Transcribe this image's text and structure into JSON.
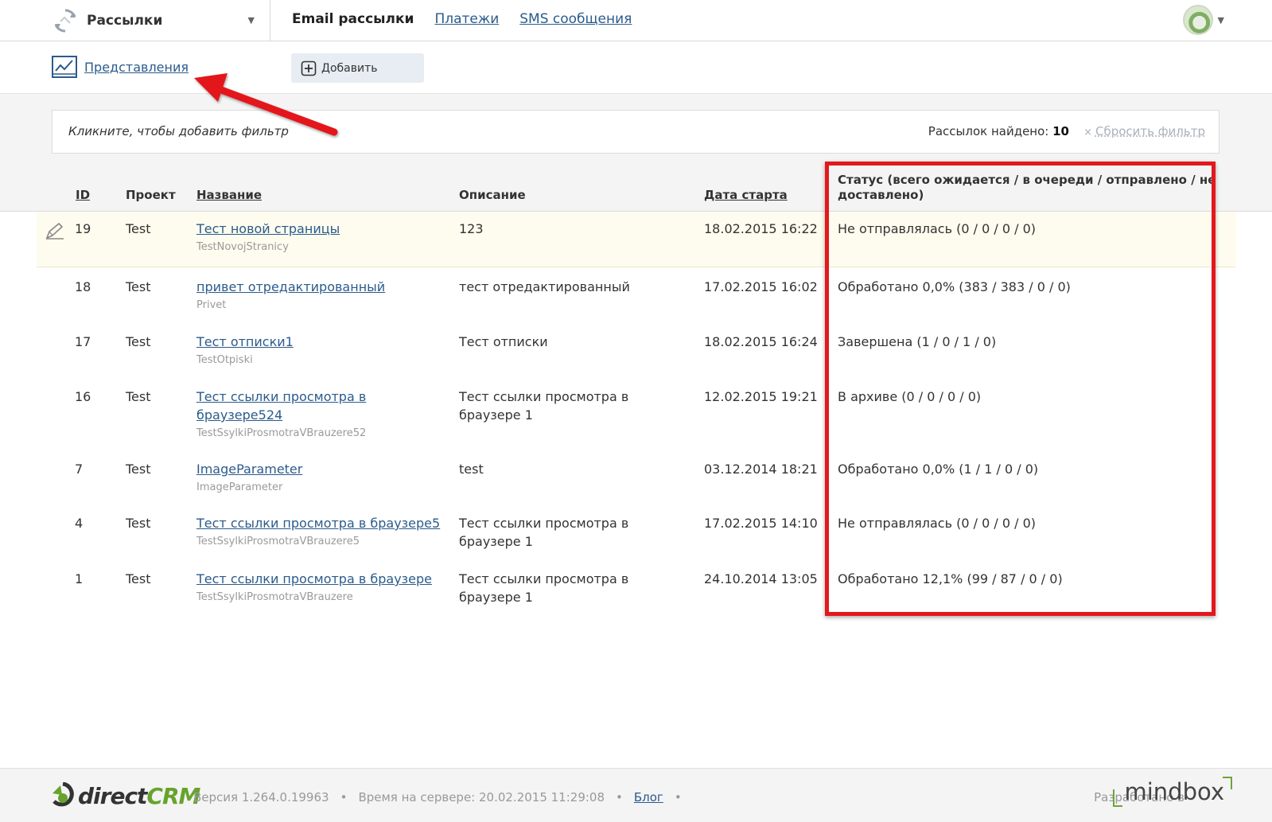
{
  "topbar": {
    "module_name": "Рассылки",
    "nav": {
      "current": "Email рассылки",
      "links": [
        "Платежи",
        "SMS сообщения"
      ]
    }
  },
  "actions": {
    "views_label": "Представления",
    "add_label": "Добавить"
  },
  "filter": {
    "hint": "Кликните, чтобы добавить фильтр",
    "found_label": "Рассылок найдено:",
    "found_count": "10",
    "reset_label": "Сбросить фильтр"
  },
  "table": {
    "headers": {
      "id": "ID",
      "project": "Проект",
      "name": "Название",
      "description": "Описание",
      "start_date": "Дата старта",
      "status_line1": "Статус (всего ожидается / в очереди / отправлено / не",
      "status_line2": "доставлено)"
    },
    "rows": [
      {
        "id": "19",
        "project": "Test",
        "name": "Тест новой страницы",
        "name2": "",
        "system": "TestNovojStranicy",
        "desc": "123",
        "desc2": "",
        "date": "18.02.2015 16:22",
        "status": "Не отправлялась (0 / 0 / 0 / 0)"
      },
      {
        "id": "18",
        "project": "Test",
        "name": "привет отредактированный",
        "name2": "",
        "system": "Privet",
        "desc": "тест отредактированный",
        "desc2": "",
        "date": "17.02.2015 16:02",
        "status": "Обработано 0,0% (383 / 383 / 0 / 0)"
      },
      {
        "id": "17",
        "project": "Test",
        "name": "Тест отписки1",
        "name2": "",
        "system": "TestOtpiski",
        "desc": "Тест отписки",
        "desc2": "",
        "date": "18.02.2015 16:24",
        "status": "Завершена (1 / 0 / 1 / 0)"
      },
      {
        "id": "16",
        "project": "Test",
        "name": "Тест ссылки просмотра в",
        "name2": "браузере524",
        "system": "TestSsylkiProsmotraVBrauzere52",
        "desc": "Тест ссылки просмотра в",
        "desc2": "браузере 1",
        "date": "12.02.2015 19:21",
        "status": "В архиве (0 / 0 / 0 / 0)"
      },
      {
        "id": "7",
        "project": "Test",
        "name": "ImageParameter",
        "name2": "",
        "system": "ImageParameter",
        "desc": "test",
        "desc2": "",
        "date": "03.12.2014 18:21",
        "status": "Обработано 0,0% (1 / 1 / 0 / 0)"
      },
      {
        "id": "4",
        "project": "Test",
        "name": "Тест ссылки просмотра в браузере5",
        "name2": "",
        "system": "TestSsylkiProsmotraVBrauzere5",
        "desc": "Тест ссылки просмотра в",
        "desc2": "браузере 1",
        "date": "17.02.2015 14:10",
        "status": "Не отправлялась (0 / 0 / 0 / 0)"
      },
      {
        "id": "1",
        "project": "Test",
        "name": "Тест ссылки просмотра в браузере",
        "name2": "",
        "system": "TestSsylkiProsmotraVBrauzere",
        "desc": "Тест ссылки просмотра в",
        "desc2": "браузере 1",
        "date": "24.10.2014 13:05",
        "status": "Обработано 12,1% (99 / 87 / 0 / 0)"
      }
    ]
  },
  "footer": {
    "brand_part1": "direct",
    "brand_part2": "CRM",
    "version": "Версия 1.264.0.19963",
    "server_time": "Время на сервере: 20.02.2015 11:29:08",
    "blog": "Блог",
    "developed_by": "Разработано в",
    "developer_brand": "mindbox"
  },
  "colors": {
    "link": "#2b5b8c",
    "annotation_red": "#e3181d",
    "highlight_row": "#fdfcee",
    "brand_green": "#67a32c"
  }
}
